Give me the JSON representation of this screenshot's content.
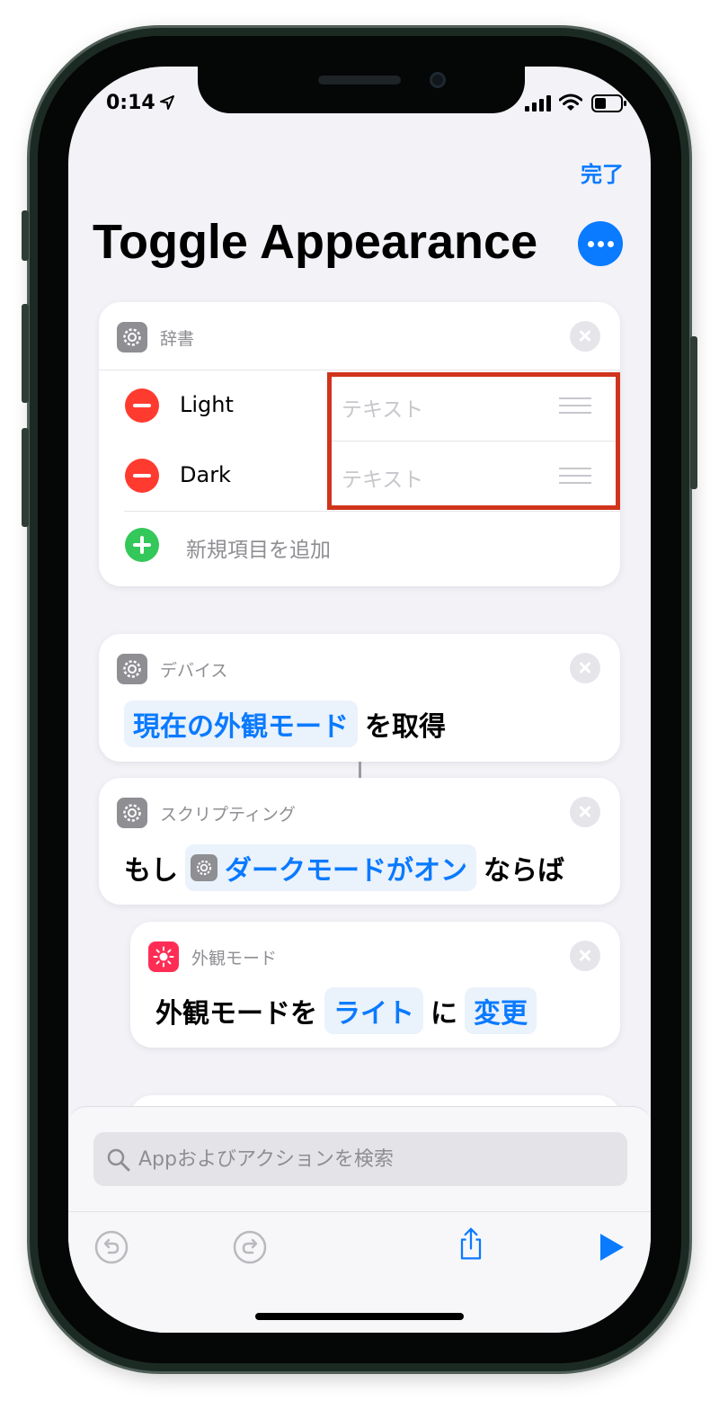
{
  "status_bar": {
    "time": "0:14"
  },
  "header": {
    "done_label": "完了",
    "title": "Toggle Appearance"
  },
  "dictionary_action": {
    "category": "辞書",
    "rows": [
      {
        "key": "Light",
        "value_placeholder": "テキスト"
      },
      {
        "key": "Dark",
        "value_placeholder": "テキスト"
      }
    ],
    "add_label": "新規項目を追加"
  },
  "device_action": {
    "category": "デバイス",
    "token": "現在の外観モード",
    "suffix": "を取得"
  },
  "if_action": {
    "category": "スクリプティング",
    "prefix": "もし",
    "token": "ダークモードがオン",
    "suffix": "ならば"
  },
  "appearance_action": {
    "category": "外観モード",
    "prefix": "外観モードを",
    "token_mode": "ライト",
    "middle": "に",
    "token_action": "変更"
  },
  "search": {
    "placeholder": "Appおよびアクションを検索"
  },
  "colors": {
    "accent": "#0a7aff",
    "delete": "#ff3b30",
    "add": "#34c759",
    "highlight": "#d0341c",
    "appearance_icon": "#ff2d55"
  },
  "icons": {
    "location": "location-arrow-icon",
    "signal": "cellular-signal-icon",
    "wifi": "wifi-icon",
    "battery": "battery-icon",
    "settings": "gear-icon",
    "appearance": "sun-icon",
    "search": "search-icon",
    "undo": "undo-icon",
    "redo": "redo-icon",
    "share": "share-icon",
    "run": "play-icon"
  }
}
